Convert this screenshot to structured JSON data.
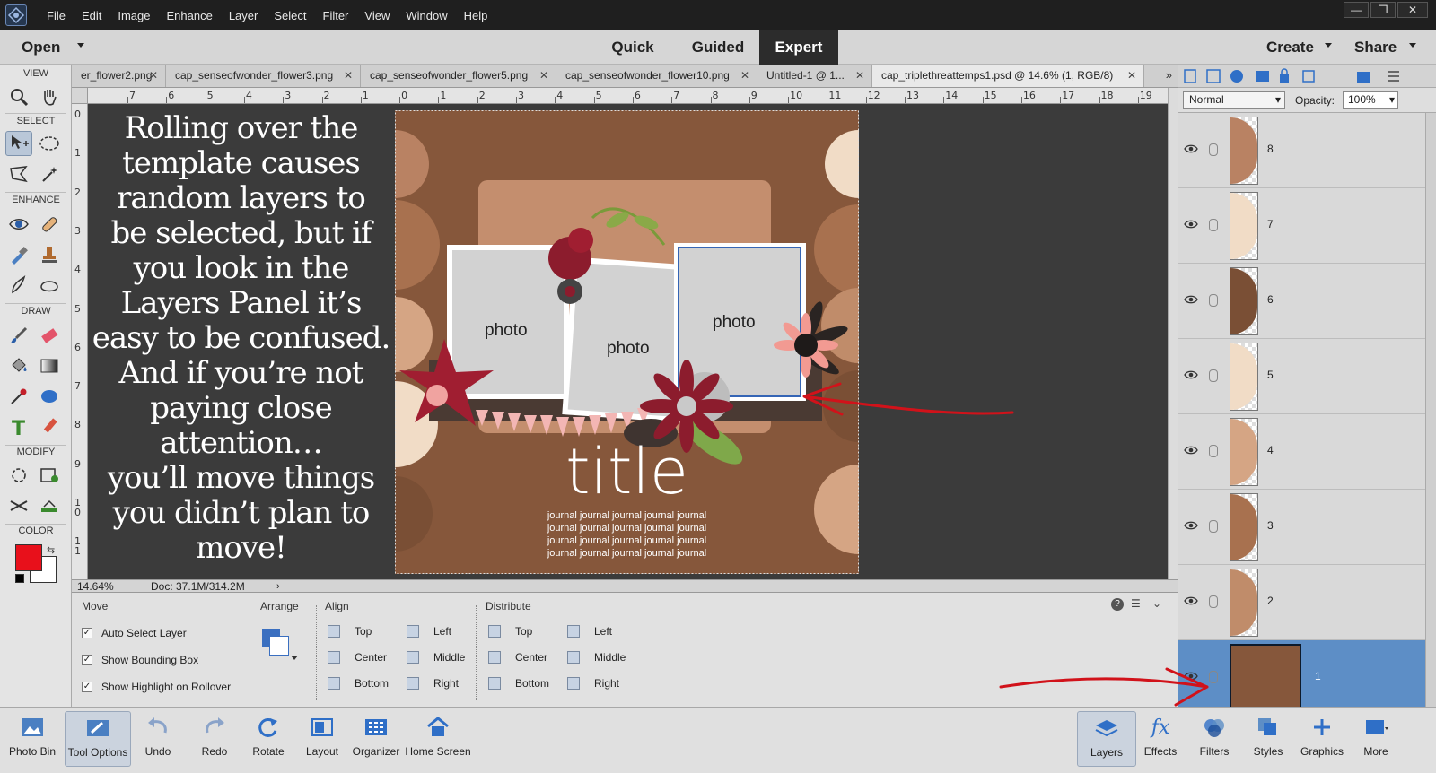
{
  "menubar": {
    "items": [
      "File",
      "Edit",
      "Image",
      "Enhance",
      "Layer",
      "Select",
      "Filter",
      "View",
      "Window",
      "Help"
    ],
    "window_buttons": [
      "—",
      "❐",
      "✕"
    ]
  },
  "modebar": {
    "open_label": "Open",
    "modes": [
      "Quick",
      "Guided",
      "Expert"
    ],
    "active_mode": "Expert",
    "create_label": "Create",
    "share_label": "Share"
  },
  "toolbox": {
    "sections": [
      "VIEW",
      "SELECT",
      "ENHANCE",
      "DRAW",
      "MODIFY",
      "COLOR"
    ],
    "foreground_color": "#e8101b",
    "background_color": "#ffffff"
  },
  "tabs": [
    {
      "label": "er_flower2.png",
      "active": false
    },
    {
      "label": "cap_senseofwonder_flower3.png",
      "active": false
    },
    {
      "label": "cap_senseofwonder_flower5.png",
      "active": false
    },
    {
      "label": "cap_senseofwonder_flower10.png",
      "active": false
    },
    {
      "label": "Untitled-1 @ 1...",
      "active": false
    },
    {
      "label": "cap_triplethreattemps1.psd @ 14.6% (1, RGB/8)",
      "active": true
    }
  ],
  "ruler": {
    "horizontal": [
      "7",
      "6",
      "5",
      "4",
      "3",
      "2",
      "1",
      "0",
      "1",
      "2",
      "3",
      "4",
      "5",
      "6",
      "7",
      "8",
      "9",
      "10",
      "11",
      "12",
      "13",
      "14",
      "15",
      "16",
      "17",
      "18",
      "19"
    ],
    "vertical": [
      "0",
      "1",
      "2",
      "3",
      "4",
      "5",
      "6",
      "7",
      "8",
      "9",
      "1\n0",
      "1\n1"
    ]
  },
  "canvas": {
    "note_lines": [
      "Rolling over the",
      "template causes",
      "random layers to",
      "be selected, but if",
      "you look in the",
      "Layers Panel it’s",
      "easy to be confused.",
      "And if you’re not",
      "paying close",
      "attention…",
      "you’ll move things",
      "you didn’t plan to",
      "move!"
    ],
    "photo_labels": [
      "photo",
      "photo",
      "photo"
    ],
    "title_text": "title",
    "journal_lines": [
      "journal journal journal journal journal",
      "journal journal journal journal journal",
      "journal journal journal journal journal",
      "journal journal journal journal journal"
    ]
  },
  "status": {
    "zoom": "14.64%",
    "doc_size": "Doc: 37.1M/314.2M"
  },
  "tool_options": {
    "move_header": "Move",
    "arrange_header": "Arrange",
    "align_header": "Align",
    "distribute_header": "Distribute",
    "checkboxes": [
      {
        "label": "Auto Select Layer",
        "checked": true
      },
      {
        "label": "Show Bounding Box",
        "checked": true
      },
      {
        "label": "Show Highlight on Rollover",
        "checked": true
      }
    ],
    "align_col1": [
      "Top",
      "Center",
      "Bottom"
    ],
    "align_col2": [
      "Left",
      "Middle",
      "Right"
    ],
    "distribute_col1": [
      "Top",
      "Center",
      "Bottom"
    ],
    "distribute_col2": [
      "Left",
      "Middle",
      "Right"
    ]
  },
  "layers_panel": {
    "blend_mode": "Normal",
    "opacity_label": "Opacity:",
    "opacity_value": "100%",
    "layers": [
      {
        "name": "8",
        "fill": "#b98263",
        "active": false
      },
      {
        "name": "7",
        "fill": "#f1dcc6",
        "active": false
      },
      {
        "name": "6",
        "fill": "#7a4f35",
        "active": false
      },
      {
        "name": "5",
        "fill": "#f1dcc6",
        "active": false
      },
      {
        "name": "4",
        "fill": "#d5a584",
        "active": false
      },
      {
        "name": "3",
        "fill": "#a8714f",
        "active": false
      },
      {
        "name": "2",
        "fill": "#c08c6a",
        "active": false
      },
      {
        "name": "1",
        "fill": "#86573b",
        "active": true
      }
    ]
  },
  "taskbar": {
    "left": [
      "Photo Bin",
      "Tool Options",
      "Undo",
      "Redo",
      "Rotate",
      "Layout",
      "Organizer",
      "Home Screen"
    ],
    "right": [
      "Layers",
      "Effects",
      "Filters",
      "Styles",
      "Graphics",
      "More"
    ]
  },
  "colors": {
    "accent_blue": "#5d8ec6",
    "annotation_red": "#d1121a",
    "background_paper": "#86573b"
  }
}
